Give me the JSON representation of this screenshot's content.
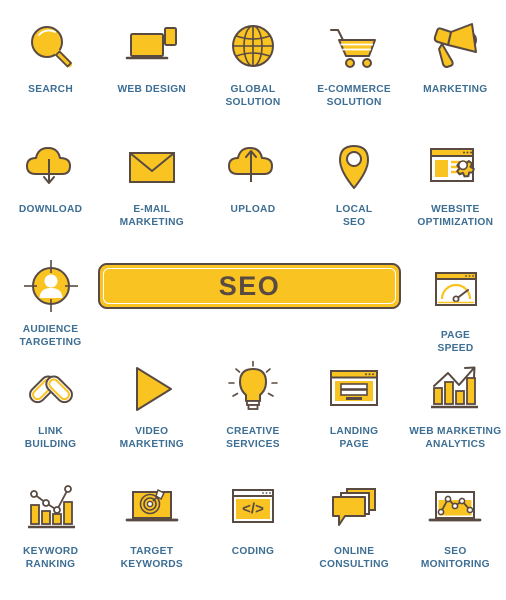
{
  "page": {
    "title": "SEO Icon Set",
    "background_color": "#ffffff",
    "accent_color": "#f9c322",
    "outline_color": "#594a42",
    "label_color": "#3d6e93"
  },
  "banner": {
    "text": "SEO",
    "fill_color": "#f9c322",
    "border_color": "#594a42",
    "text_color": "#594a42"
  },
  "rows": [
    {
      "items": [
        {
          "label": "SEARCH",
          "icon": "magnifier-icon"
        },
        {
          "label": "WEB DESIGN",
          "icon": "laptop-devices-icon"
        },
        {
          "label": "GLOBAL\nSOLUTION",
          "icon": "globe-icon"
        },
        {
          "label": "E-COMMERCE\nSOLUTION",
          "icon": "shopping-cart-icon"
        },
        {
          "label": "MARKETING",
          "icon": "megaphone-icon"
        }
      ]
    },
    {
      "items": [
        {
          "label": "DOWNLOAD",
          "icon": "cloud-download-icon"
        },
        {
          "label": "E-MAIL\nMARKETING",
          "icon": "envelope-icon"
        },
        {
          "label": "UPLOAD",
          "icon": "cloud-upload-icon"
        },
        {
          "label": "LOCAL\nSEO",
          "icon": "map-pin-icon"
        },
        {
          "label": "WEBSITE\nOPTIMIZATION",
          "icon": "browser-gear-icon"
        }
      ]
    },
    {
      "items": [
        {
          "label": "AUDIENCE\nTARGETING",
          "icon": "audience-target-icon"
        },
        {
          "label": "PAGE\nSPEED",
          "icon": "speedometer-browser-icon"
        }
      ]
    },
    {
      "items": [
        {
          "label": "LINK\nBUILDING",
          "icon": "chain-link-icon"
        },
        {
          "label": "VIDEO\nMARKETING",
          "icon": "play-button-icon"
        },
        {
          "label": "CREATIVE\nSERVICES",
          "icon": "lightbulb-icon"
        },
        {
          "label": "LANDING\nPAGE",
          "icon": "landing-page-icon"
        },
        {
          "label": "WEB MARKETING\nANALYTICS",
          "icon": "bar-chart-arrow-icon"
        }
      ]
    },
    {
      "items": [
        {
          "label": "KEYWORD\nRANKING",
          "icon": "chart-line-bars-icon"
        },
        {
          "label": "TARGET\nKEYWORDS",
          "icon": "laptop-target-icon"
        },
        {
          "label": "CODING",
          "icon": "code-browser-icon"
        },
        {
          "label": "ONLINE\nCONSULTING",
          "icon": "speech-bubbles-icon"
        },
        {
          "label": "SEO\nMONITORING",
          "icon": "laptop-line-chart-icon"
        }
      ]
    }
  ]
}
